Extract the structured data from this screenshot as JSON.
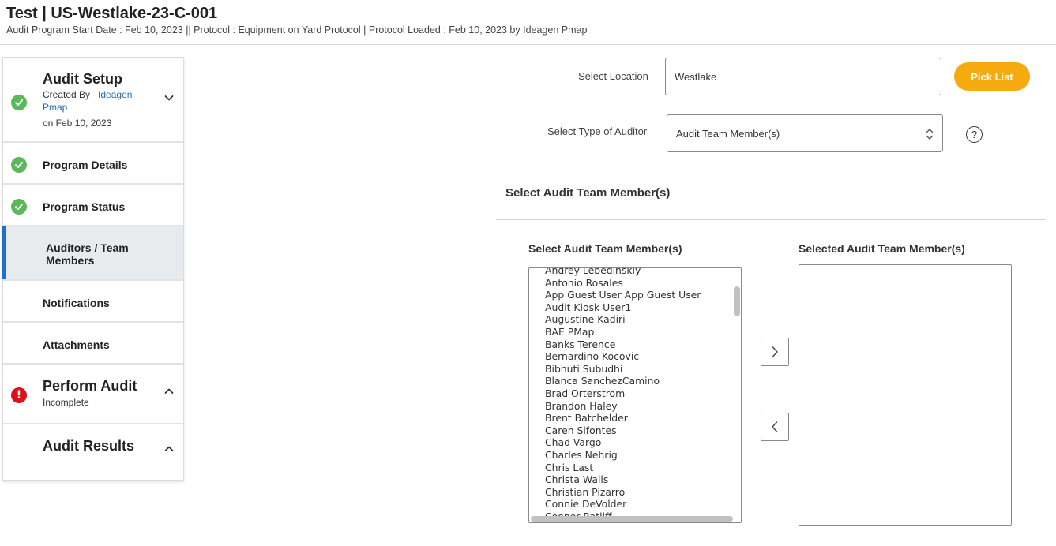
{
  "header": {
    "title": "Test | US-Westlake-23-C-001",
    "subtitle": "Audit Program Start Date : Feb 10, 2023 || Protocol : Equipment on Yard Protocol | Protocol Loaded : Feb 10, 2023 by Ideagen Pmap"
  },
  "sidebar": {
    "audit_setup": {
      "title": "Audit Setup",
      "created_by_label": "Created By",
      "created_by_name": "Ideagen Pmap",
      "created_on": "on Feb 10, 2023",
      "status_icon": "check-icon"
    },
    "items": [
      {
        "label": "Program Details",
        "status": "complete"
      },
      {
        "label": "Program Status",
        "status": "complete"
      },
      {
        "label": "Auditors / Team Members",
        "status": "active"
      },
      {
        "label": "Notifications",
        "status": "none"
      },
      {
        "label": "Attachments",
        "status": "none"
      }
    ],
    "perform_audit": {
      "title": "Perform Audit",
      "status_text": "Incomplete",
      "status_icon": "exclamation-icon"
    },
    "audit_results": {
      "title": "Audit Results"
    }
  },
  "form": {
    "location_label": "Select Location",
    "location_value": "Westlake",
    "pick_list_label": "Pick List",
    "auditor_type_label": "Select Type of Auditor",
    "auditor_type_value": "Audit Team Member(s)",
    "help_symbol": "?"
  },
  "team": {
    "section_heading": "Select Audit Team Member(s)",
    "available_heading": "Select Audit Team Member(s)",
    "selected_heading": "Selected Audit Team Member(s)",
    "available_members": [
      "Andrey Lebedinskiy",
      "Antonio Rosales",
      "App Guest User App Guest User",
      "Audit Kiosk User1",
      "Augustine Kadiri",
      "BAE PMap",
      "Banks Terence",
      "Bernardino Kocovic",
      "Bibhuti Subudhi",
      "Blanca SanchezCamino",
      "Brad Orterstrom",
      "Brandon Haley",
      "Brent Batchelder",
      "Caren Sifontes",
      "Chad Vargo",
      "Charles Nehrig",
      "Chris Last",
      "Christa Walls",
      "Christian Pizarro",
      "Connie DeVolder",
      "Cooper Ratliff"
    ],
    "selected_members": [],
    "add_icon": "chevron-right-icon",
    "remove_icon": "chevron-left-icon"
  },
  "colors": {
    "accent": "#1f6fd1",
    "pick_button": "#f5aa0f",
    "complete": "#5cb85c",
    "error": "#e0101a",
    "link": "#2a6cb0"
  }
}
